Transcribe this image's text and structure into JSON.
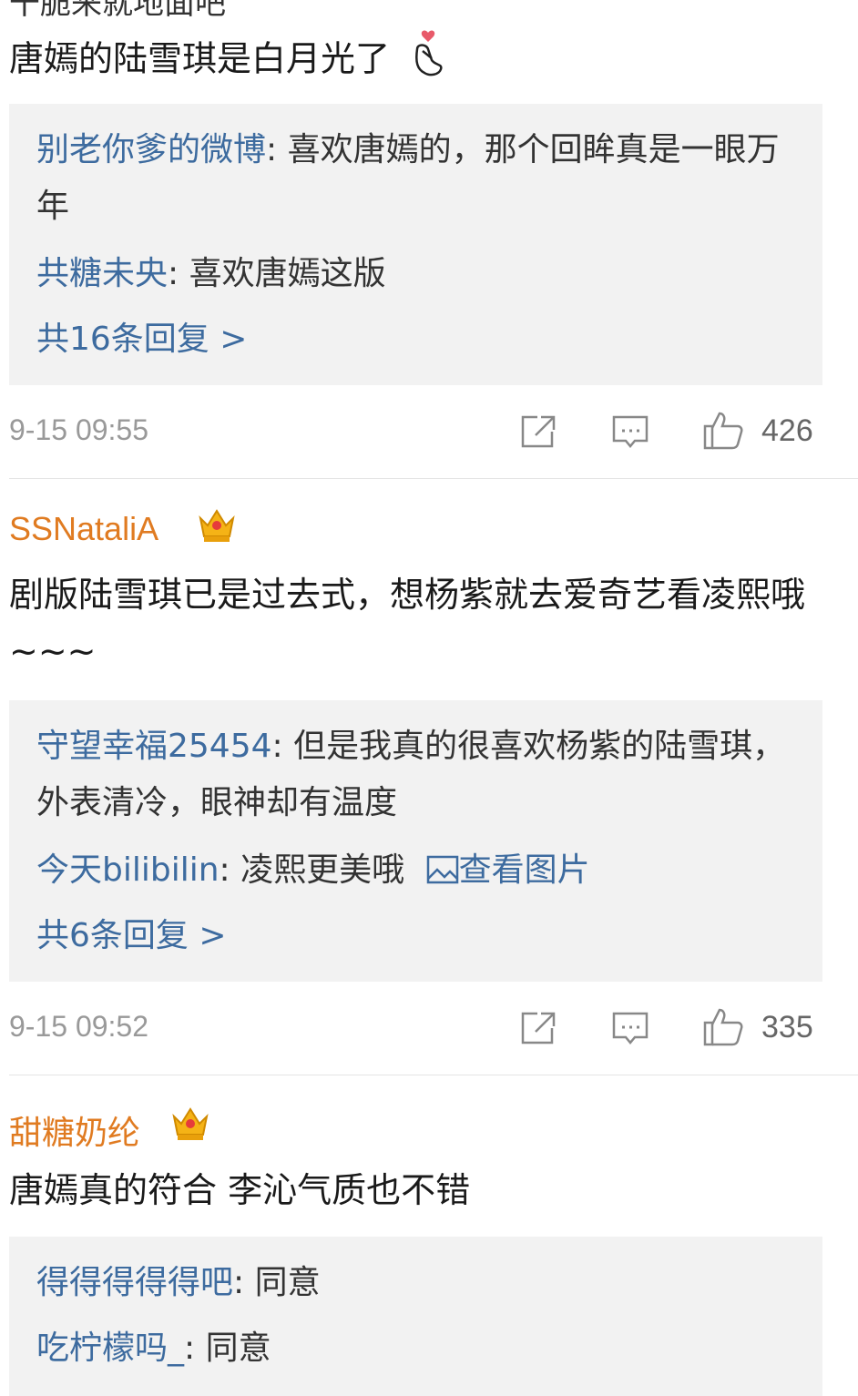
{
  "top_cut_text": "干脆来就地面吧",
  "comments": [
    {
      "text": "唐嫣的陆雪琪是白月光了",
      "emoji_icon": "finger-heart-icon",
      "replies": [
        {
          "user": "别老你爹的微博",
          "sep": ": ",
          "text": "喜欢唐嫣的，那个回眸真是一眼万年"
        },
        {
          "user": "共糖未央",
          "sep": ": ",
          "text": "喜欢唐嫣这版"
        }
      ],
      "more": "共16条回复 >",
      "time": "9-15 09:55",
      "likes": "426"
    },
    {
      "username": "SSNataliA",
      "badge_icon": "crown-badge-icon",
      "text": "剧版陆雪琪已是过去式，想杨紫就去爱奇艺看凌熙哦~~~",
      "replies": [
        {
          "user": "守望幸福25454",
          "sep": ": ",
          "text": "但是我真的很喜欢杨紫的陆雪琪，外表清冷，眼神却有温度"
        },
        {
          "user": "今天bilibilin",
          "sep": ": ",
          "text": "凌熙更美哦",
          "link": "查看图片"
        }
      ],
      "more": "共6条回复 >",
      "time": "9-15 09:52",
      "likes": "335"
    },
    {
      "username": "甜糖奶纶",
      "badge_icon": "crown-badge-icon",
      "text": "唐嫣真的符合 李沁气质也不错",
      "replies": [
        {
          "user": "得得得得得吧",
          "sep": ": ",
          "text": "同意"
        },
        {
          "user": "吃柠檬吗_",
          "sep": ": ",
          "text": "同意"
        }
      ]
    }
  ],
  "icons": {
    "share": "share-icon",
    "comment": "comment-icon",
    "like": "like-icon"
  },
  "colors": {
    "link": "#3d6b9f",
    "username": "#e07b21",
    "meta": "#999999",
    "reply_bg": "#f2f2f2"
  }
}
